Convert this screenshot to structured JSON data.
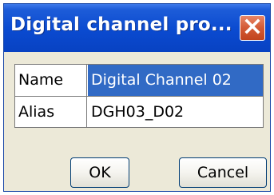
{
  "dialog": {
    "title": "Digital channel pro...",
    "close_icon": "close-x-icon",
    "colors": {
      "title_bar": "#0a4ad0",
      "close_button": "#d35a35",
      "selection": "#316ac5",
      "body": "#ece9d8"
    }
  },
  "properties": [
    {
      "label": "Name",
      "value": "Digital Channel 02",
      "selected": true
    },
    {
      "label": "Alias",
      "value": "DGH03_D02",
      "selected": false
    }
  ],
  "buttons": {
    "ok_label": "OK",
    "cancel_label": "Cancel"
  }
}
